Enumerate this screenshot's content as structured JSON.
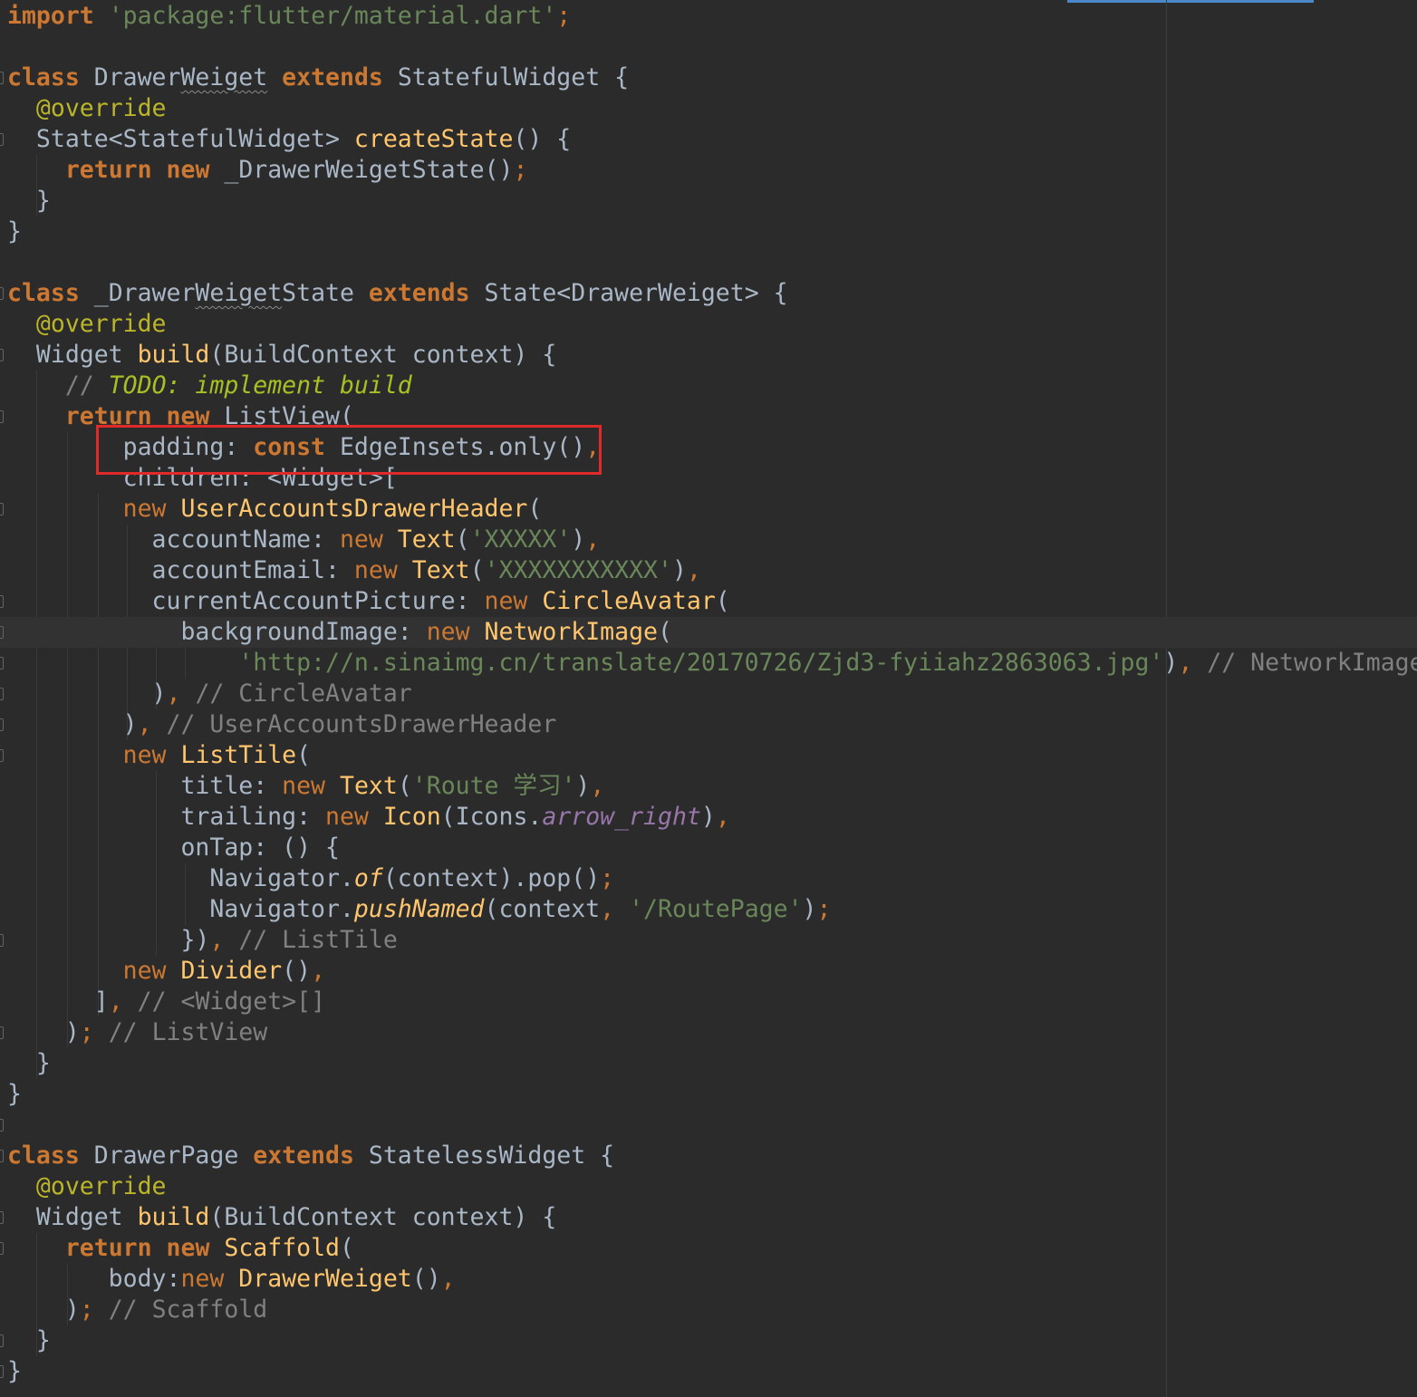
{
  "editor": {
    "language": "dart",
    "highlight_note": "padding: const EdgeInsets.only(),",
    "lines": [
      [
        [
          "kw",
          "import"
        ],
        [
          "plain",
          " "
        ],
        [
          "str",
          "'package:flutter/material.dart'"
        ],
        [
          "punct",
          ";"
        ]
      ],
      [],
      [
        [
          "kw",
          "class"
        ],
        [
          "plain",
          " Drawer"
        ],
        [
          "sq",
          "Weiget"
        ],
        [
          "plain",
          " "
        ],
        [
          "kw",
          "extends"
        ],
        [
          "plain",
          " StatefulWidget {"
        ]
      ],
      [
        [
          "plain",
          "  "
        ],
        [
          "ann",
          "@override"
        ]
      ],
      [
        [
          "plain",
          "  State<StatefulWidget> "
        ],
        [
          "fn",
          "createState"
        ],
        [
          "plain",
          "() {"
        ]
      ],
      [
        [
          "plain",
          "    "
        ],
        [
          "kw",
          "return"
        ],
        [
          "plain",
          " "
        ],
        [
          "kw",
          "new"
        ],
        [
          "plain",
          " _DrawerWeigetState()"
        ],
        [
          "punct",
          ";"
        ]
      ],
      [
        [
          "plain",
          "  }"
        ]
      ],
      [
        [
          "plain",
          "}"
        ]
      ],
      [],
      [
        [
          "kw",
          "class"
        ],
        [
          "plain",
          " _Drawer"
        ],
        [
          "sq",
          "Weiget"
        ],
        [
          "plain",
          "State "
        ],
        [
          "kw",
          "extends"
        ],
        [
          "plain",
          " State<DrawerWeiget> {"
        ]
      ],
      [
        [
          "plain",
          "  "
        ],
        [
          "ann",
          "@override"
        ]
      ],
      [
        [
          "plain",
          "  Widget "
        ],
        [
          "fn",
          "build"
        ],
        [
          "plain",
          "(BuildContext context) {"
        ]
      ],
      [
        [
          "plain",
          "    "
        ],
        [
          "cmt",
          "// "
        ],
        [
          "todo",
          "TODO: implement build"
        ]
      ],
      [
        [
          "plain",
          "    "
        ],
        [
          "kw",
          "return"
        ],
        [
          "plain",
          " "
        ],
        [
          "kw",
          "new"
        ],
        [
          "plain",
          " ListView("
        ]
      ],
      [
        [
          "plain",
          "        padding: "
        ],
        [
          "kw",
          "const"
        ],
        [
          "plain",
          " EdgeInsets.only()"
        ],
        [
          "punct",
          ","
        ]
      ],
      [
        [
          "plain",
          "        children: <Widget>["
        ]
      ],
      [
        [
          "plain",
          "        "
        ],
        [
          "kwn",
          "new"
        ],
        [
          "plain",
          " "
        ],
        [
          "fn",
          "UserAccountsDrawerHeader"
        ],
        [
          "plain",
          "("
        ]
      ],
      [
        [
          "plain",
          "          accountName: "
        ],
        [
          "kwn",
          "new"
        ],
        [
          "plain",
          " "
        ],
        [
          "fn",
          "Text"
        ],
        [
          "plain",
          "("
        ],
        [
          "str",
          "'XXXXX'"
        ],
        [
          "plain",
          ")"
        ],
        [
          "punct",
          ","
        ]
      ],
      [
        [
          "plain",
          "          accountEmail: "
        ],
        [
          "kwn",
          "new"
        ],
        [
          "plain",
          " "
        ],
        [
          "fn",
          "Text"
        ],
        [
          "plain",
          "("
        ],
        [
          "str",
          "'XXXXXXXXXXX'"
        ],
        [
          "plain",
          ")"
        ],
        [
          "punct",
          ","
        ]
      ],
      [
        [
          "plain",
          "          currentAccountPicture: "
        ],
        [
          "kwn",
          "new"
        ],
        [
          "plain",
          " "
        ],
        [
          "fn",
          "CircleAvatar"
        ],
        [
          "plain",
          "("
        ]
      ],
      [
        [
          "plain",
          "            backgroundImage: "
        ],
        [
          "kwn",
          "new"
        ],
        [
          "plain",
          " "
        ],
        [
          "fn",
          "NetworkImage"
        ],
        [
          "plain",
          "("
        ]
      ],
      [
        [
          "plain",
          "                "
        ],
        [
          "str",
          "'http://n.sinaimg.cn/translate/20170726/Zjd3-fyiiahz2863063.jpg'"
        ],
        [
          "plain",
          ")"
        ],
        [
          "punct",
          ","
        ],
        [
          "plain",
          " "
        ],
        [
          "cmt",
          "// NetworkImage"
        ]
      ],
      [
        [
          "plain",
          "          )"
        ],
        [
          "punct",
          ","
        ],
        [
          "plain",
          " "
        ],
        [
          "cmt",
          "// CircleAvatar"
        ]
      ],
      [
        [
          "plain",
          "        )"
        ],
        [
          "punct",
          ","
        ],
        [
          "plain",
          " "
        ],
        [
          "cmt",
          "// UserAccountsDrawerHeader"
        ]
      ],
      [
        [
          "plain",
          "        "
        ],
        [
          "kwn",
          "new"
        ],
        [
          "plain",
          " "
        ],
        [
          "fn",
          "ListTile"
        ],
        [
          "plain",
          "("
        ]
      ],
      [
        [
          "plain",
          "            title: "
        ],
        [
          "kwn",
          "new"
        ],
        [
          "plain",
          " "
        ],
        [
          "fn",
          "Text"
        ],
        [
          "plain",
          "("
        ],
        [
          "str",
          "'Route 学习'"
        ],
        [
          "plain",
          ")"
        ],
        [
          "punct",
          ","
        ]
      ],
      [
        [
          "plain",
          "            trailing: "
        ],
        [
          "kwn",
          "new"
        ],
        [
          "plain",
          " "
        ],
        [
          "fn",
          "Icon"
        ],
        [
          "plain",
          "(Icons."
        ],
        [
          "field",
          "arrow_right"
        ],
        [
          "plain",
          ")"
        ],
        [
          "punct",
          ","
        ]
      ],
      [
        [
          "plain",
          "            onTap: () {"
        ]
      ],
      [
        [
          "plain",
          "              Navigator."
        ],
        [
          "static",
          "of"
        ],
        [
          "plain",
          "(context).pop()"
        ],
        [
          "punct",
          ";"
        ]
      ],
      [
        [
          "plain",
          "              Navigator."
        ],
        [
          "static",
          "pushNamed"
        ],
        [
          "plain",
          "(context"
        ],
        [
          "punct",
          ","
        ],
        [
          "plain",
          " "
        ],
        [
          "str",
          "'/RoutePage'"
        ],
        [
          "plain",
          ")"
        ],
        [
          "punct",
          ";"
        ]
      ],
      [
        [
          "plain",
          "            })"
        ],
        [
          "punct",
          ","
        ],
        [
          "plain",
          " "
        ],
        [
          "cmt",
          "// ListTile"
        ]
      ],
      [
        [
          "plain",
          "        "
        ],
        [
          "kwn",
          "new"
        ],
        [
          "plain",
          " "
        ],
        [
          "fn",
          "Divider"
        ],
        [
          "plain",
          "()"
        ],
        [
          "punct",
          ","
        ]
      ],
      [
        [
          "plain",
          "      ]"
        ],
        [
          "punct",
          ","
        ],
        [
          "plain",
          " "
        ],
        [
          "cmt",
          "// <Widget>[]"
        ]
      ],
      [
        [
          "plain",
          "    )"
        ],
        [
          "punct",
          ";"
        ],
        [
          "plain",
          " "
        ],
        [
          "cmt",
          "// ListView"
        ]
      ],
      [
        [
          "plain",
          "  }"
        ]
      ],
      [
        [
          "plain",
          "}"
        ]
      ],
      [],
      [
        [
          "kw",
          "class"
        ],
        [
          "plain",
          " DrawerPage "
        ],
        [
          "kw",
          "extends"
        ],
        [
          "plain",
          " StatelessWidget {"
        ]
      ],
      [
        [
          "plain",
          "  "
        ],
        [
          "ann",
          "@override"
        ]
      ],
      [
        [
          "plain",
          "  Widget "
        ],
        [
          "fn",
          "build"
        ],
        [
          "plain",
          "(BuildContext context) {"
        ]
      ],
      [
        [
          "plain",
          "    "
        ],
        [
          "kw",
          "return"
        ],
        [
          "plain",
          " "
        ],
        [
          "kw",
          "new"
        ],
        [
          "plain",
          " "
        ],
        [
          "fn",
          "Scaffold"
        ],
        [
          "plain",
          "("
        ]
      ],
      [
        [
          "plain",
          "       body:"
        ],
        [
          "kwn",
          "new"
        ],
        [
          "plain",
          " "
        ],
        [
          "fn",
          "DrawerWeiget"
        ],
        [
          "plain",
          "()"
        ],
        [
          "punct",
          ","
        ]
      ],
      [
        [
          "plain",
          "    )"
        ],
        [
          "punct",
          ";"
        ],
        [
          "plain",
          " "
        ],
        [
          "cmt",
          "// Scaffold"
        ]
      ],
      [
        [
          "plain",
          "  }"
        ]
      ],
      [
        [
          "plain",
          "}"
        ]
      ]
    ]
  },
  "colors": {
    "background": "#2b2b2b",
    "caret_line": "#323232",
    "keyword": "#cc7832",
    "string": "#6a8759",
    "function": "#ffc66d",
    "comment": "#808080",
    "todo": "#a8c023",
    "annotation": "#bbb529",
    "field": "#9876aa",
    "default": "#a9b7c6",
    "highlight_box": "#e02a2a"
  }
}
